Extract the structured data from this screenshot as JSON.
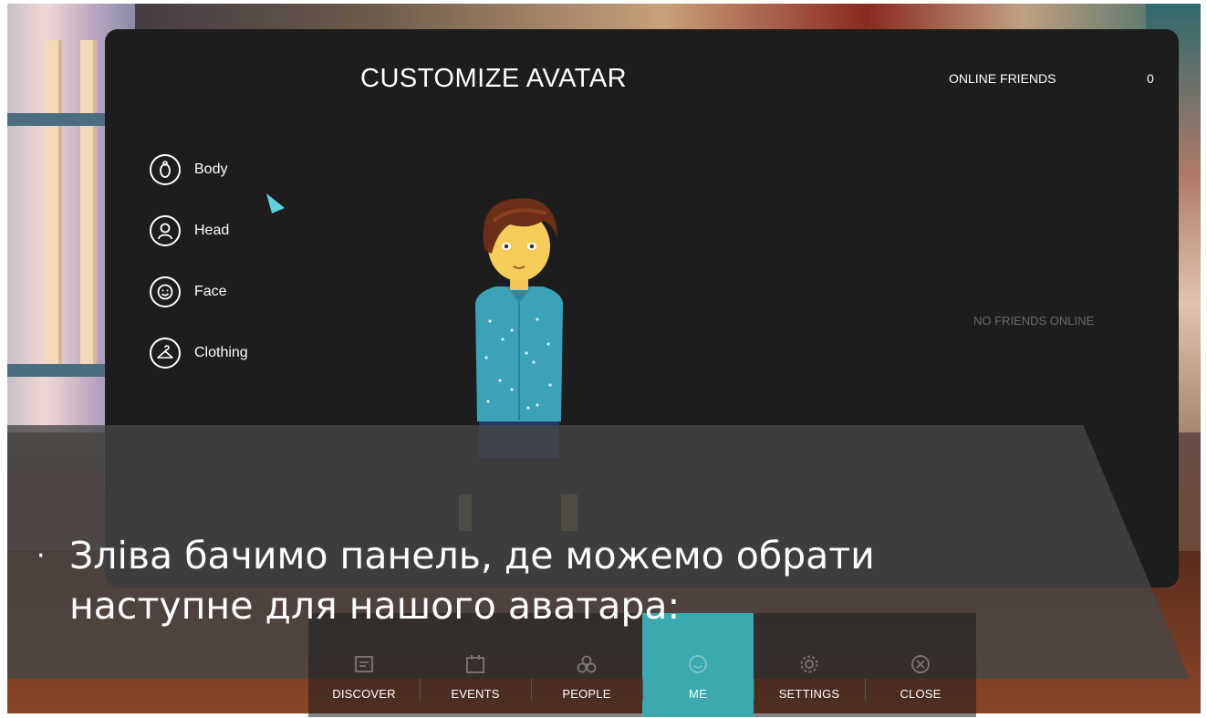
{
  "panel": {
    "title": "CUSTOMIZE AVATAR",
    "friends_title": "ONLINE FRIENDS",
    "friends_count": "0",
    "no_friends": "NO FRIENDS ONLINE"
  },
  "menu": [
    {
      "label": "Body",
      "icon": "body-icon"
    },
    {
      "label": "Head",
      "icon": "head-icon"
    },
    {
      "label": "Face",
      "icon": "face-icon"
    },
    {
      "label": "Clothing",
      "icon": "hanger-icon"
    }
  ],
  "slide": {
    "bullet": "·",
    "line1": "Зліва бачимо панель, де можемо обрати",
    "line2": "наступне для нашого аватара:"
  },
  "nav": [
    {
      "label": "DISCOVER",
      "icon": "discover-icon"
    },
    {
      "label": "EVENTS",
      "icon": "calendar-icon"
    },
    {
      "label": "PEOPLE",
      "icon": "people-icon"
    },
    {
      "label": "ME",
      "icon": "smiley-icon",
      "active": true
    },
    {
      "label": "SETTINGS",
      "icon": "gear-icon"
    },
    {
      "label": "CLOSE",
      "icon": "close-icon"
    }
  ],
  "colors": {
    "panel_bg": "#1d1d1d",
    "accent": "#3aa9b0",
    "cursor": "#5fd3e0"
  }
}
